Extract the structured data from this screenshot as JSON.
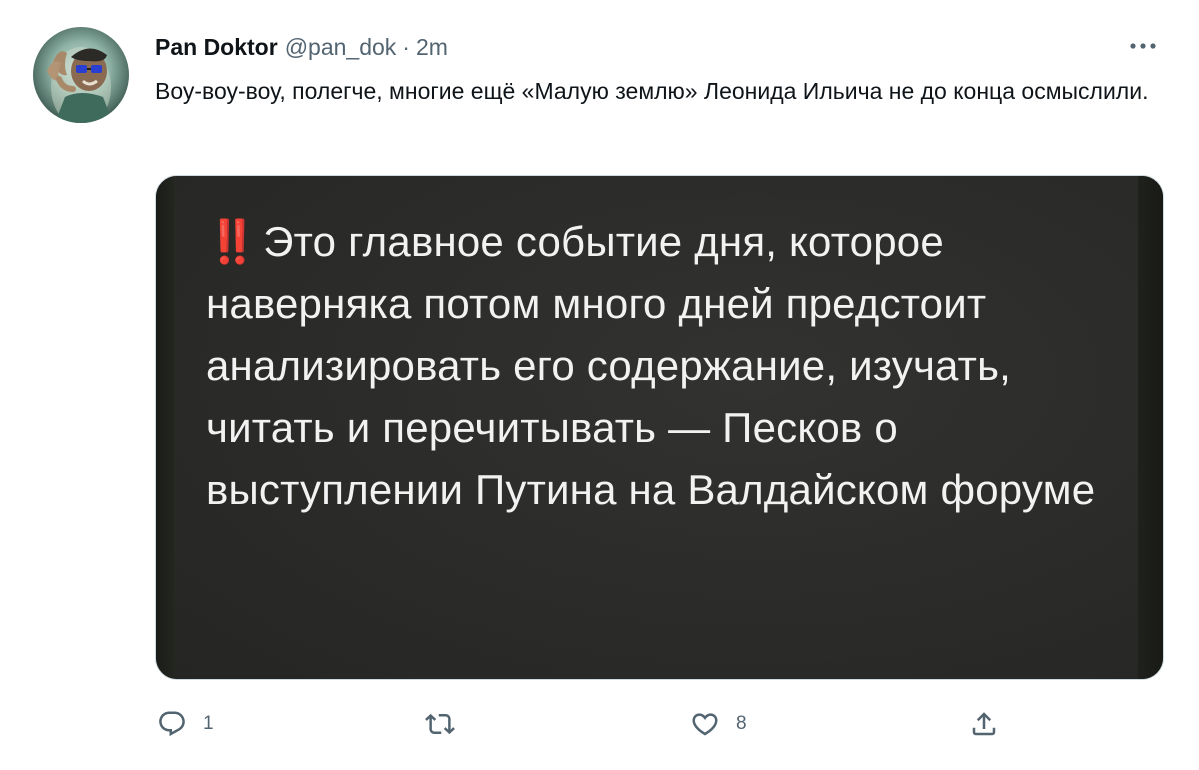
{
  "tweet": {
    "display_name": "Pan Doktor",
    "handle": "@pan_dok",
    "separator": "·",
    "time": "2m",
    "text": "Воу-воу-воу, полегче, многие ещё «Малую землю» Леонида Ильича не до конца осмыслили.",
    "avatar_icon": "avatar-image",
    "more_icon": "ellipsis-icon"
  },
  "media": {
    "emoji": "‼️",
    "text": "Это главное событие дня, которое наверняка потом много дней предстоит анализировать его содержание, изучать, читать и перечитывать — Песков о выступлении Путина на Валдайском форуме",
    "background_color": "#2b2b29",
    "text_color": "#f2f2f2",
    "emoji_color": "#e0241b"
  },
  "actions": {
    "reply": {
      "icon": "reply-icon",
      "count": "1"
    },
    "retweet": {
      "icon": "retweet-icon",
      "count": ""
    },
    "like": {
      "icon": "heart-icon",
      "count": "8"
    },
    "share": {
      "icon": "share-icon",
      "count": ""
    }
  },
  "colors": {
    "primary_text": "#0f1419",
    "secondary_text": "#536471",
    "border": "#cfd9de"
  }
}
